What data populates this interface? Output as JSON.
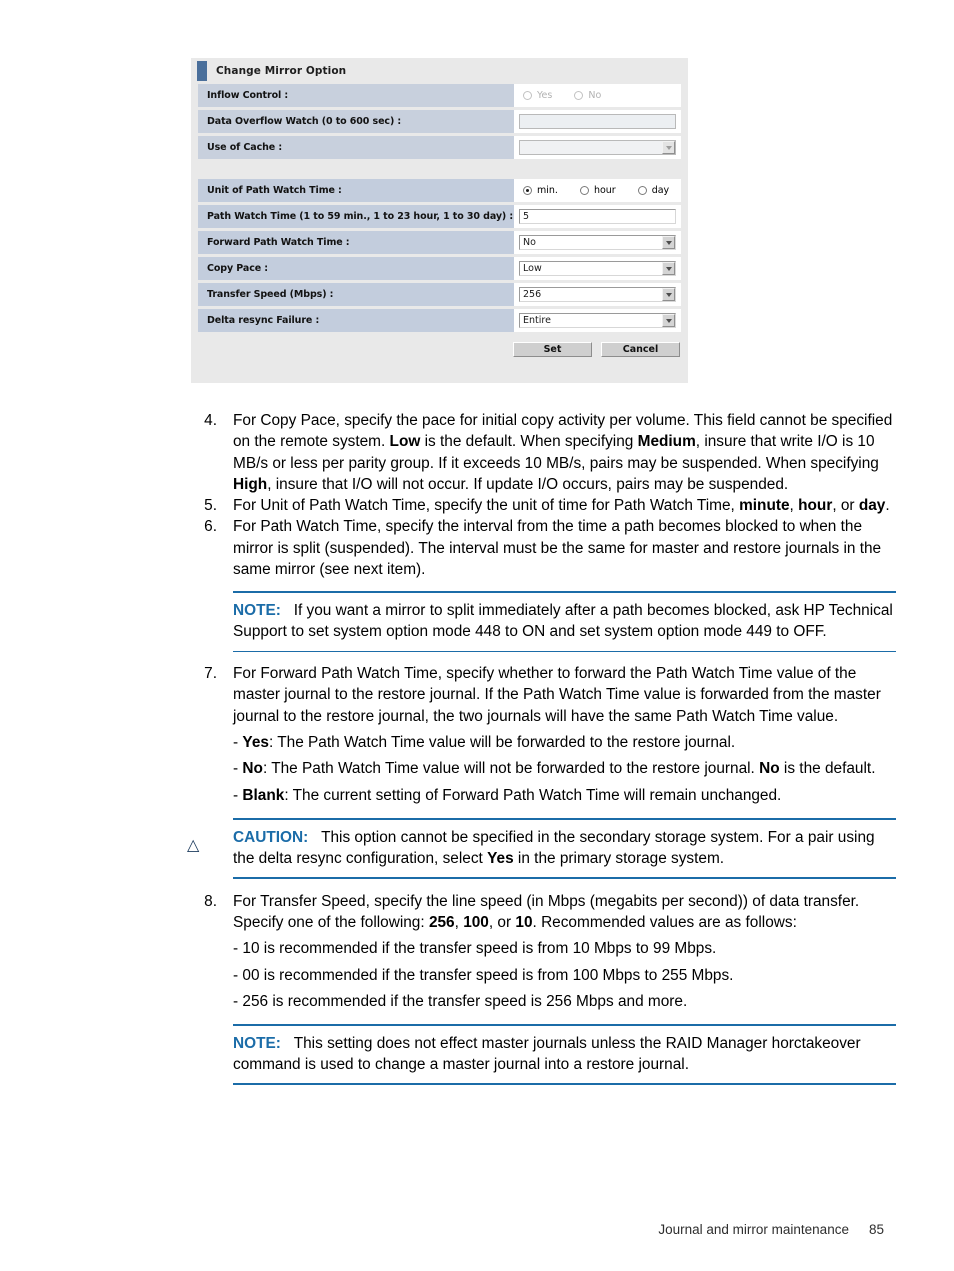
{
  "dialog": {
    "title": "Change Mirror Option",
    "rows_top": [
      {
        "label": "Inflow Control :",
        "control": "radio",
        "disabled": true,
        "options": [
          {
            "label": "Yes",
            "checked": false
          },
          {
            "label": "No",
            "checked": false
          }
        ]
      },
      {
        "label": "Data Overflow Watch (0 to 600 sec) :",
        "control": "text",
        "disabled": true,
        "value": ""
      },
      {
        "label": "Use of Cache :",
        "control": "combo",
        "disabled": true,
        "value": ""
      }
    ],
    "rows_bottom": [
      {
        "label": "Unit of Path Watch Time :",
        "control": "radio",
        "disabled": false,
        "options": [
          {
            "label": "min.",
            "checked": true
          },
          {
            "label": "hour",
            "checked": false
          },
          {
            "label": "day",
            "checked": false
          }
        ]
      },
      {
        "label": "Path Watch Time (1 to 59 min., 1 to 23 hour, 1 to 30 day) :",
        "control": "text",
        "disabled": false,
        "value": "5"
      },
      {
        "label": "Forward Path Watch Time :",
        "control": "combo",
        "disabled": false,
        "value": "No"
      },
      {
        "label": "Copy Pace :",
        "control": "combo",
        "disabled": false,
        "value": "Low"
      },
      {
        "label": "Transfer Speed (Mbps) :",
        "control": "combo",
        "disabled": false,
        "value": "256"
      },
      {
        "label": "Delta resync Failure :",
        "control": "combo",
        "disabled": false,
        "value": "Entire"
      }
    ],
    "buttons": {
      "set": "Set",
      "cancel": "Cancel"
    },
    "accent_color": "#4a6f9b",
    "label_color": "#c3cddd"
  },
  "content": {
    "item4": {
      "number": "4.",
      "p1": "For Copy Pace, specify the pace for initial copy activity per volume. This field cannot be specified on the remote system. ",
      "b1": "Low",
      "p2": " is the default. When specifying ",
      "b2": "Medium",
      "p3": ", insure that write I/O is 10 MB/s or less per parity group. If it exceeds 10 MB/s, pairs may be suspended. When specifying ",
      "b3": "High",
      "p4": ", insure that I/O will not occur. If update I/O occurs, pairs may be suspended."
    },
    "item5": {
      "number": "5.",
      "p1": "For Unit of Path Watch Time, specify the unit of time for Path Watch Time, ",
      "b1": "minute",
      "p2": ", ",
      "b2": "hour",
      "p3": ", or ",
      "b3": "day",
      "p4": "."
    },
    "item6": {
      "number": "6.",
      "p1": "For Path Watch Time, specify the interval from the time a path becomes blocked to when the mirror is split (suspended). The interval must be the same for master and restore journals in the same mirror (see next item)."
    },
    "note1": {
      "keyword": "NOTE:",
      "text": "If you want a mirror to split immediately after a path becomes blocked, ask HP Technical Support to set system option mode 448 to ON and set system option mode 449 to OFF."
    },
    "item7": {
      "number": "7.",
      "p1": "For Forward Path Watch Time, specify whether to forward the Path Watch Time value of the master journal to the restore journal. If the Path Watch Time value is forwarded from the master journal to the restore journal, the two journals will have the same Path Watch Time value.",
      "sub": [
        {
          "dash": "- ",
          "bold": "Yes",
          "rest": ": The Path Watch Time value will be forwarded to the restore journal."
        },
        {
          "dash": "- ",
          "bold": "No",
          "rest": ": The Path Watch Time value will not be forwarded to the restore journal. ",
          "bold2": "No",
          "rest2": " is the default."
        },
        {
          "dash": "- ",
          "bold": "Blank",
          "rest": ": The current setting of Forward Path Watch Time will remain unchanged."
        }
      ]
    },
    "caution": {
      "icon": "△",
      "keyword": "CAUTION:",
      "p1": "This option cannot be specified in the secondary storage system. For a pair using the delta resync configuration, select ",
      "b1": "Yes",
      "p2": " in the primary storage system."
    },
    "item8": {
      "number": "8.",
      "p1": "For Transfer Speed, specify the line speed (in Mbps (megabits per second)) of data transfer. Specify one of the following: ",
      "b1": "256",
      "p2": ", ",
      "b2": "100",
      "p3": ", or ",
      "b3": "10",
      "p4": ". Recommended values are as follows:",
      "sub": [
        "- 10 is recommended if the transfer speed is from 10 Mbps to 99 Mbps.",
        "- 00 is recommended if the transfer speed is from 100 Mbps to 255 Mbps.",
        "- 256 is recommended if the transfer speed is 256 Mbps and more."
      ]
    },
    "note2": {
      "keyword": "NOTE:",
      "text": "This setting does not effect master journals unless the RAID Manager horctakeover command is used to change a master journal into a restore journal."
    }
  },
  "footer": {
    "chapter": "Journal and mirror maintenance",
    "page": "85"
  }
}
